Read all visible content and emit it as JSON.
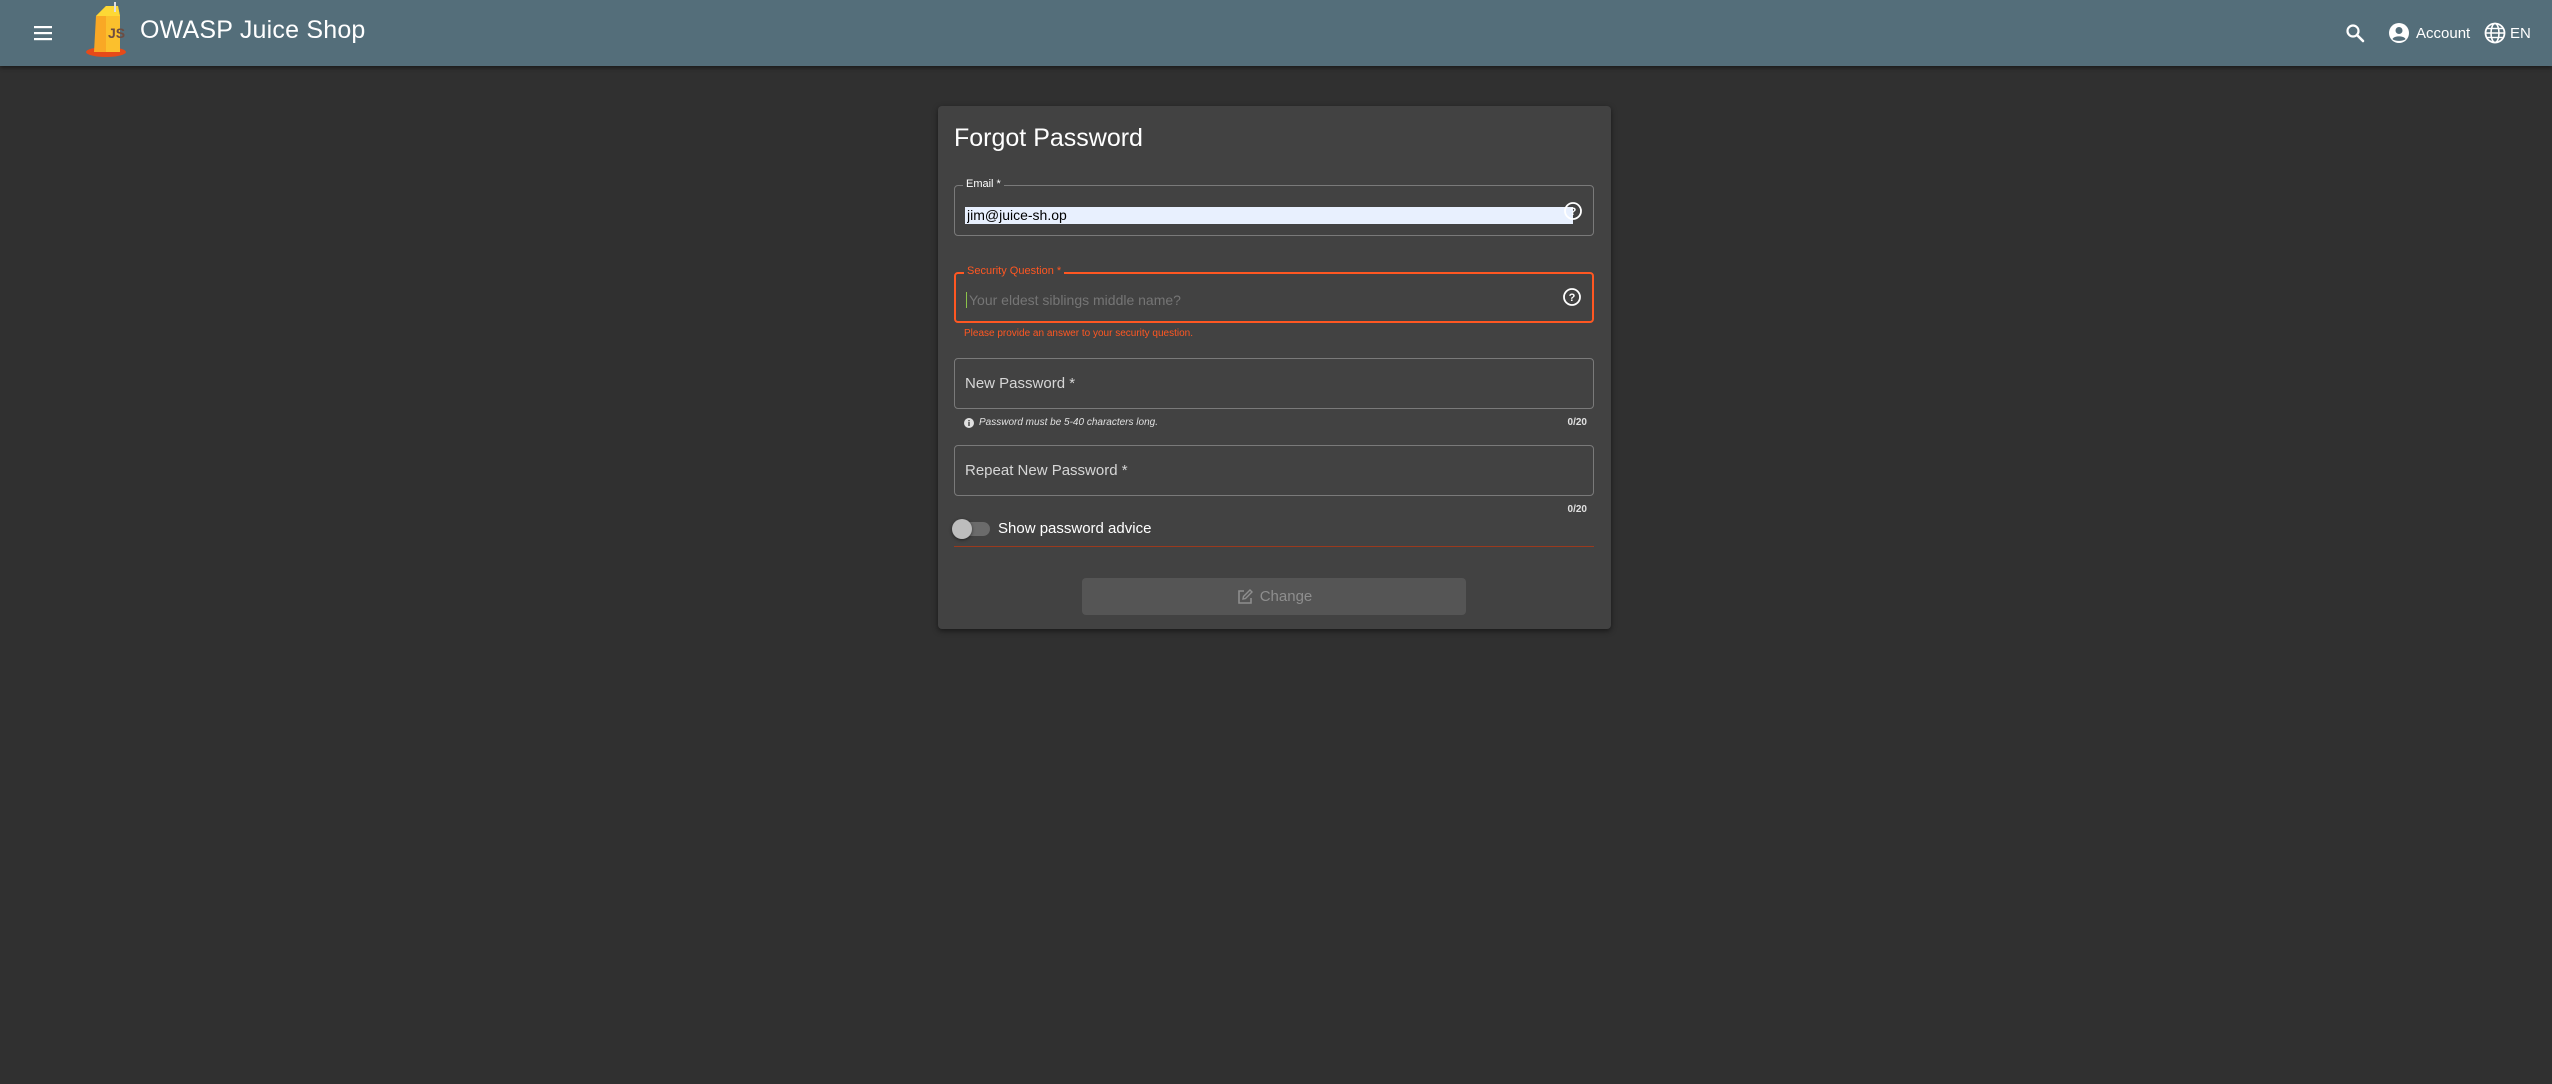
{
  "toolbar": {
    "app_title": "OWASP Juice Shop",
    "account_label": "Account",
    "language_label": "EN",
    "menu_icon": "menu-icon",
    "search_icon": "search-icon",
    "account_icon": "account-circle-icon",
    "language_icon": "globe-icon",
    "background_color": "#546e7a"
  },
  "form": {
    "title": "Forgot Password",
    "email": {
      "label": "Email *",
      "value": "jim@juice-sh.op"
    },
    "security_question": {
      "label": "Security Question *",
      "placeholder": "Your eldest siblings middle name?",
      "error": "Please provide an answer to your security question."
    },
    "new_password": {
      "label": "New Password *",
      "hint": "Password must be 5-40 characters long.",
      "counter": "0/20"
    },
    "repeat_password": {
      "label": "Repeat New Password *",
      "counter": "0/20"
    },
    "password_advice_toggle": "Show password advice",
    "submit_label": "Change",
    "error_color": "#ff5722"
  }
}
